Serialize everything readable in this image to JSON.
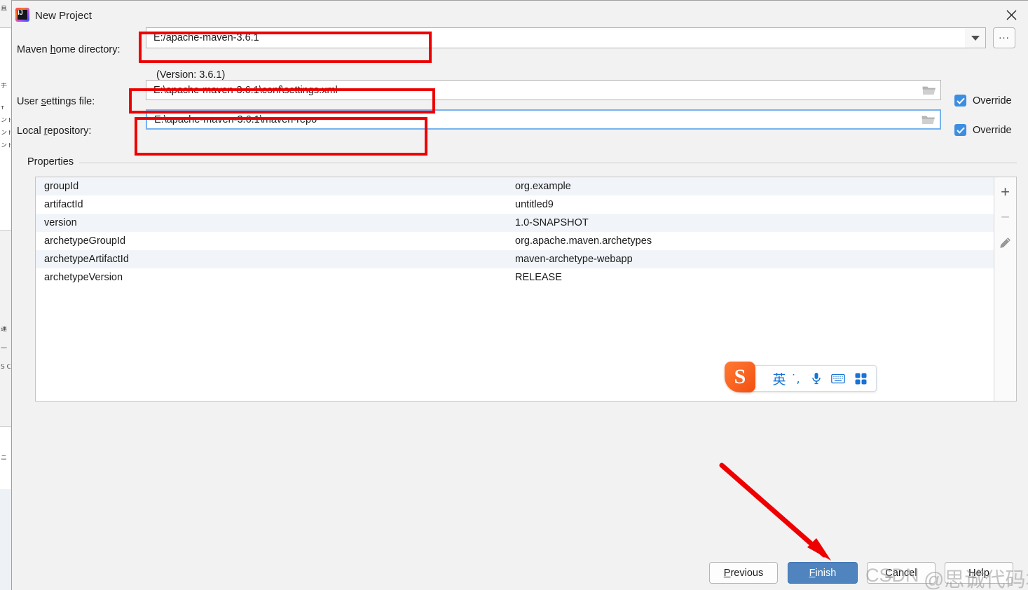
{
  "window": {
    "title": "New Project",
    "app_icon": "intellij-idea-icon",
    "close_label": "✕"
  },
  "form": {
    "maven_home": {
      "label_pre": "Maven ",
      "label_mnemonic": "h",
      "label_post": "ome directory:",
      "value": "E:/apache-maven-3.6.1",
      "dropdown_icon": "chevron-down-icon",
      "browse_label": "..."
    },
    "version_note": "(Version: 3.6.1)",
    "user_settings": {
      "label_pre": "User ",
      "label_mnemonic": "s",
      "label_post": "ettings file:",
      "value": "E:\\apache-maven-3.6.1\\conf\\settings.xml",
      "browse_icon": "folder-icon",
      "override_label": "Override",
      "override_checked": true
    },
    "local_repository": {
      "label_pre": "Local ",
      "label_mnemonic": "r",
      "label_post": "epository:",
      "value": "E:\\apache-maven-3.6.1\\maven-repo",
      "browse_icon": "folder-icon",
      "override_label": "Override",
      "override_checked": true,
      "focused": true
    }
  },
  "properties": {
    "section_title": "Properties",
    "rows": [
      {
        "key": "groupId",
        "value": "org.example"
      },
      {
        "key": "artifactId",
        "value": "untitled9"
      },
      {
        "key": "version",
        "value": "1.0-SNAPSHOT"
      },
      {
        "key": "archetypeGroupId",
        "value": "org.apache.maven.archetypes"
      },
      {
        "key": "archetypeArtifactId",
        "value": "maven-archetype-webapp"
      },
      {
        "key": "archetypeVersion",
        "value": "RELEASE"
      }
    ],
    "tools": [
      {
        "name": "add-property-button",
        "glyph": "+"
      },
      {
        "name": "remove-property-button",
        "glyph": "−"
      },
      {
        "name": "edit-property-button",
        "glyph": "pencil-icon"
      }
    ]
  },
  "ime": {
    "logo": "sogou-logo",
    "logo_text": "S",
    "mode_label": "英",
    "punctuation_icon": "˙,",
    "mic_icon": "microphone-icon",
    "keyboard_icon": "keyboard-icon",
    "apps_icon": "app-grid-icon"
  },
  "buttons": {
    "previous": {
      "pre": "",
      "mnemonic": "P",
      "post": "revious"
    },
    "finish": {
      "pre": "",
      "mnemonic": "F",
      "post": "inish"
    },
    "cancel": {
      "pre": "",
      "mnemonic": "C",
      "post": "ancel"
    },
    "help": {
      "pre": "",
      "mnemonic": "H",
      "post": "elp"
    }
  },
  "annotations": {
    "highlight_color": "#ee0000",
    "arrow_color": "#ee0000",
    "boxes": 3
  },
  "watermark": {
    "csdn": "CSDN",
    "author": "@思诚代码块"
  },
  "colors": {
    "accent_blue": "#3d8ee0",
    "primary_button": "#4f84be",
    "annotation_red": "#ee0000",
    "sogou_orange": "#f24f12",
    "row_alt": "#f1f5fa",
    "dialog_bg": "#f2f2f2"
  }
}
